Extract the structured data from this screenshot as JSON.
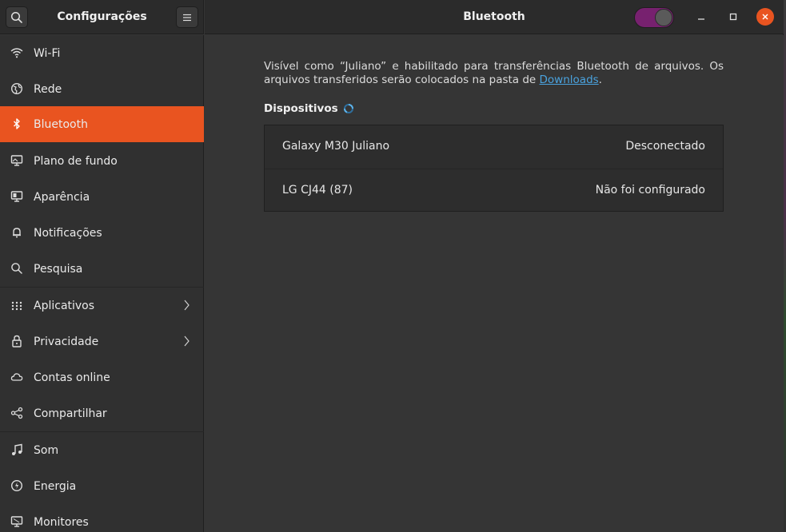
{
  "header": {
    "left_title": "Configurações",
    "right_title": "Bluetooth",
    "bluetooth_enabled": true
  },
  "sidebar": {
    "items": [
      {
        "label": "Wi-Fi",
        "icon": "wifi-icon"
      },
      {
        "label": "Rede",
        "icon": "network-globe-icon"
      },
      {
        "label": "Bluetooth",
        "icon": "bluetooth-icon",
        "active": true
      },
      {
        "label": "Plano de fundo",
        "icon": "wallpaper-icon"
      },
      {
        "label": "Aparência",
        "icon": "appearance-icon"
      },
      {
        "label": "Notificações",
        "icon": "bell-icon"
      },
      {
        "label": "Pesquisa",
        "icon": "search-icon"
      },
      {
        "label": "Aplicativos",
        "icon": "apps-grid-icon",
        "has_submenu": true
      },
      {
        "label": "Privacidade",
        "icon": "lock-icon",
        "has_submenu": true
      },
      {
        "label": "Contas online",
        "icon": "cloud-icon"
      },
      {
        "label": "Compartilhar",
        "icon": "share-icon"
      },
      {
        "label": "Som",
        "icon": "music-note-icon"
      },
      {
        "label": "Energia",
        "icon": "power-icon"
      },
      {
        "label": "Monitores",
        "icon": "monitor-icon"
      }
    ]
  },
  "main": {
    "description_line1": "Visível como “Juliano” e habilitado para transferências Bluetooth de arquivos. Os",
    "description_line2_prefix": "arquivos transferidos serão colocados na pasta de ",
    "description_link": "Downloads",
    "description_line2_suffix": ".",
    "devices_title": "Dispositivos",
    "devices": [
      {
        "name": "Galaxy M30 Juliano",
        "status": "Desconectado"
      },
      {
        "name": "LG CJ44  (87)",
        "status": "Não foi configurado"
      }
    ]
  },
  "colors": {
    "accent": "#e95420",
    "toggle_on": "#77216f",
    "link": "#4aa3df"
  }
}
